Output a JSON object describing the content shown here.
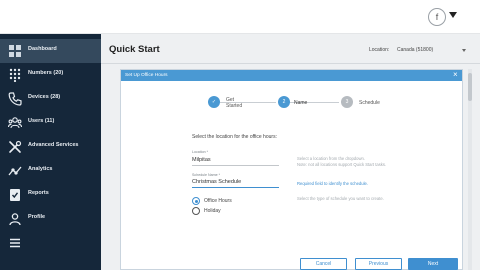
{
  "topbar": {
    "avatar_initial": "f"
  },
  "sidebar": {
    "items": [
      {
        "label": "Dashboard",
        "icon": "dashboard-icon",
        "active": true
      },
      {
        "label": "Numbers (20)",
        "icon": "dialpad-icon"
      },
      {
        "label": "Devices (28)",
        "icon": "phone-icon"
      },
      {
        "label": "Users (11)",
        "icon": "users-icon"
      },
      {
        "label": "Advanced Services",
        "icon": "tools-icon"
      },
      {
        "label": "Analytics",
        "icon": "analytics-icon"
      },
      {
        "label": "Reports",
        "icon": "reports-icon"
      },
      {
        "label": "Profile",
        "icon": "profile-icon"
      },
      {
        "label": "",
        "icon": "menu-icon"
      }
    ]
  },
  "header": {
    "title": "Quick Start",
    "location_label": "Location:",
    "location_value": "Canada (51800)"
  },
  "dialog": {
    "title": "Set Up Office Hours",
    "close": "×",
    "steps": [
      {
        "number": "✓",
        "label_line1": "Get",
        "label_line2": "Started",
        "state": "done"
      },
      {
        "number": "2",
        "label_line1": "Name",
        "label_line2": "",
        "state": "current"
      },
      {
        "number": "3",
        "label_line1": "Schedule",
        "label_line2": "",
        "state": "upcoming"
      }
    ],
    "instruction": "Select the location for the office hours:",
    "location_field": {
      "label": "Location *",
      "value": "Milpitas"
    },
    "name_field": {
      "label": "Schedule Name *",
      "value": "Christmas Schedule"
    },
    "hints": {
      "location_line1": "Select a location from the dropdown.",
      "location_line2": "Note: not all locations support Quick Start tasks.",
      "name": "Required field to identify the schedule.",
      "type": "Select the type of schedule you want to create."
    },
    "schedule_types": [
      {
        "label": "Office Hours",
        "selected": true
      },
      {
        "label": "Holiday",
        "selected": false
      }
    ],
    "buttons": {
      "cancel": "Cancel",
      "previous": "Previous",
      "next": "Next"
    }
  },
  "colors": {
    "sidebar_bg": "#15273a",
    "sidebar_active": "#34495d",
    "accent": "#3f8fd0",
    "dialog_header": "#4a99d3"
  }
}
